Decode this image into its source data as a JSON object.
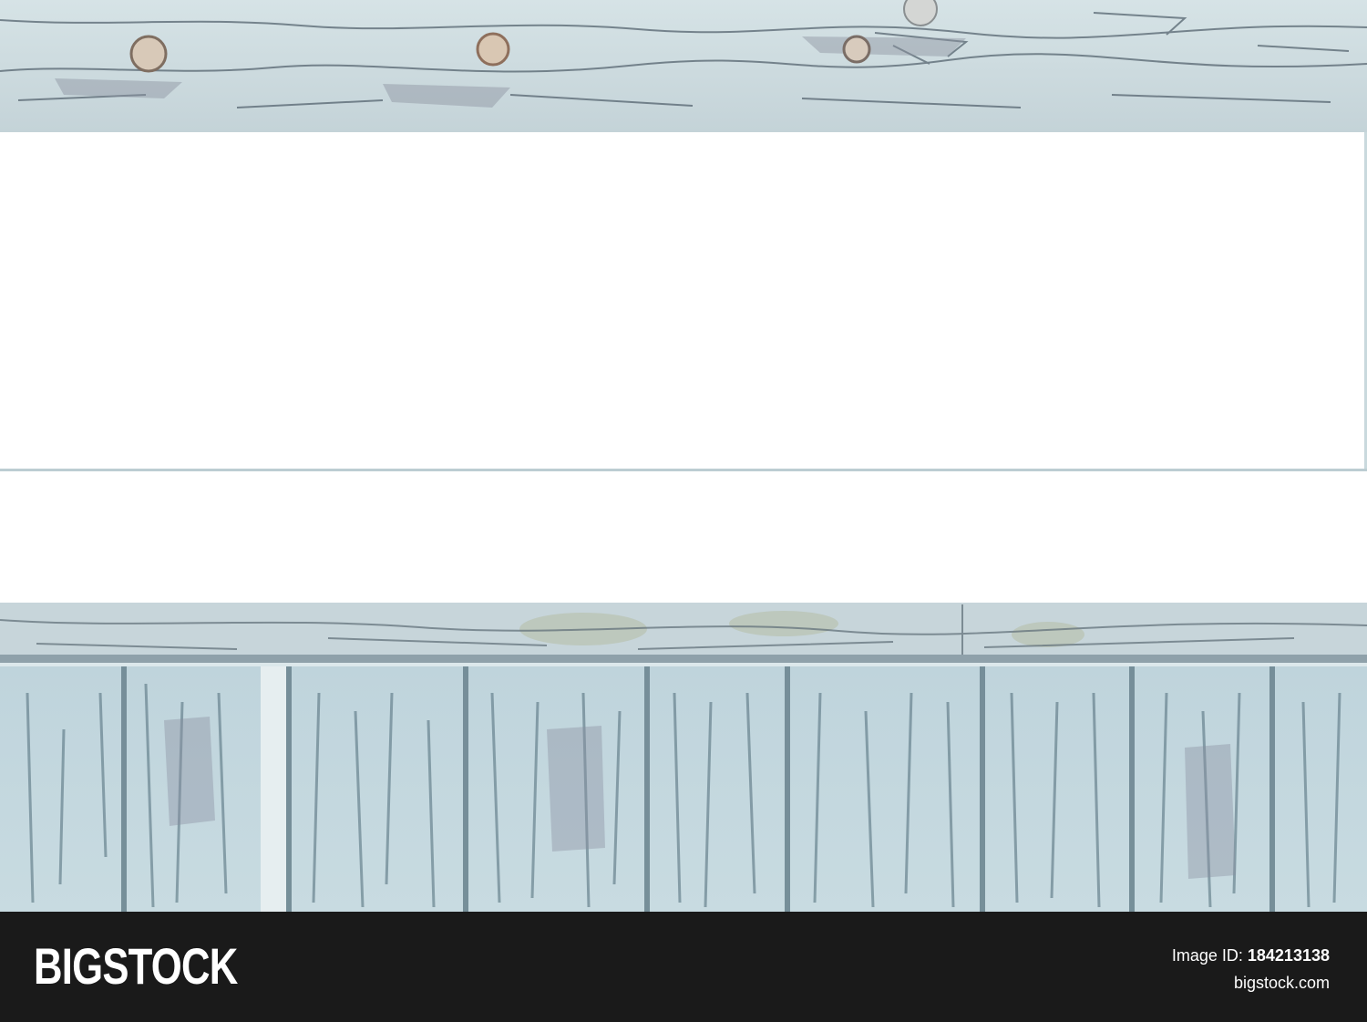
{
  "scene": {
    "subject": "weathered-painted-wood-planks",
    "colors": {
      "paint": "#cfe0e6",
      "shadow": "#5f7a86",
      "wood": "#8a8f9c",
      "panel": "#ffffff"
    }
  },
  "footer": {
    "brand": "BIGSTOCK",
    "image_id_label": "Image ID:",
    "image_id": "184213138",
    "site": "bigstock.com"
  }
}
